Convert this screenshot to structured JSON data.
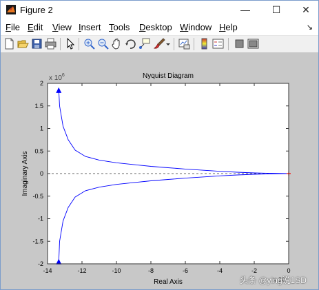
{
  "window": {
    "title": "Figure 2",
    "minimize_glyph": "—",
    "maximize_glyph": "☐",
    "close_glyph": "✕"
  },
  "menu": {
    "items": [
      {
        "pre": "",
        "key": "F",
        "post": "ile"
      },
      {
        "pre": "",
        "key": "E",
        "post": "dit"
      },
      {
        "pre": "",
        "key": "V",
        "post": "iew"
      },
      {
        "pre": "",
        "key": "I",
        "post": "nsert"
      },
      {
        "pre": "",
        "key": "T",
        "post": "ools"
      },
      {
        "pre": "",
        "key": "D",
        "post": "esktop"
      },
      {
        "pre": "",
        "key": "W",
        "post": "indow"
      },
      {
        "pre": "",
        "key": "H",
        "post": "elp"
      }
    ],
    "dock_glyph": "↘"
  },
  "toolbar": {
    "icons": [
      "new-figure-icon",
      "open-file-icon",
      "save-icon",
      "print-icon",
      "edit-plot-arrow-icon",
      "zoom-in-icon",
      "zoom-out-icon",
      "pan-hand-icon",
      "rotate-3d-icon",
      "data-cursor-icon",
      "brush-icon",
      "link-plot-icon",
      "colorbar-icon",
      "legend-icon",
      "hide-plot-tools-icon",
      "show-plot-tools-icon"
    ]
  },
  "chart_data": {
    "type": "line",
    "title": "Nyquist Diagram",
    "xlabel": "Real Axis",
    "ylabel": "Imaginary Axis",
    "xlim": [
      -14,
      0
    ],
    "ylim": [
      -2000000,
      2000000
    ],
    "x_ticks": [
      "-14",
      "-12",
      "-10",
      "-8",
      "-6",
      "-4",
      "-2",
      "0"
    ],
    "y_ticks": [
      "2",
      "1.5",
      "1",
      "0.5",
      "0",
      "-0.5",
      "-1",
      "-1.5",
      "-2"
    ],
    "y_exponent": "x 10",
    "y_exponent_power": "6",
    "x_exponent_fragment": "x 10",
    "grid": false,
    "line_color": "#0000ff",
    "critical_point_color": "#ff0000",
    "series": [
      {
        "values": [
          {
            "x": -13.35,
            "y": 1850000
          },
          {
            "x": -13.3,
            "y": 1500000
          },
          {
            "x": -13.1,
            "y": 1050000
          },
          {
            "x": -12.8,
            "y": 750000
          },
          {
            "x": -12.4,
            "y": 520000
          },
          {
            "x": -11.8,
            "y": 380000
          },
          {
            "x": -11.0,
            "y": 300000
          },
          {
            "x": -10.0,
            "y": 240000
          },
          {
            "x": -9.0,
            "y": 200000
          },
          {
            "x": -8.0,
            "y": 160000
          },
          {
            "x": -7.0,
            "y": 130000
          },
          {
            "x": -6.0,
            "y": 100000
          },
          {
            "x": -5.0,
            "y": 75000
          },
          {
            "x": -4.0,
            "y": 50000
          },
          {
            "x": -3.0,
            "y": 30000
          },
          {
            "x": -2.0,
            "y": 15000
          },
          {
            "x": -1.0,
            "y": 6000
          },
          {
            "x": 0.0,
            "y": 0
          }
        ]
      },
      {
        "values": [
          {
            "x": -13.35,
            "y": -1950000
          },
          {
            "x": -13.3,
            "y": -1500000
          },
          {
            "x": -13.1,
            "y": -1050000
          },
          {
            "x": -12.8,
            "y": -750000
          },
          {
            "x": -12.4,
            "y": -520000
          },
          {
            "x": -11.8,
            "y": -380000
          },
          {
            "x": -11.0,
            "y": -300000
          },
          {
            "x": -10.0,
            "y": -240000
          },
          {
            "x": -9.0,
            "y": -200000
          },
          {
            "x": -8.0,
            "y": -160000
          },
          {
            "x": -7.0,
            "y": -130000
          },
          {
            "x": -6.0,
            "y": -100000
          },
          {
            "x": -5.0,
            "y": -75000
          },
          {
            "x": -4.0,
            "y": -50000
          },
          {
            "x": -3.0,
            "y": -30000
          },
          {
            "x": -2.0,
            "y": -15000
          },
          {
            "x": -1.0,
            "y": -6000
          },
          {
            "x": 0.0,
            "y": 0
          }
        ]
      }
    ],
    "arrows": [
      {
        "x": -13.35,
        "y": 1850000,
        "direction": "up"
      },
      {
        "x": -13.35,
        "y": -1950000,
        "direction": "up"
      }
    ],
    "critical_point": {
      "x": 0,
      "y": 0
    }
  },
  "watermark": "头条 @ying说1SD"
}
